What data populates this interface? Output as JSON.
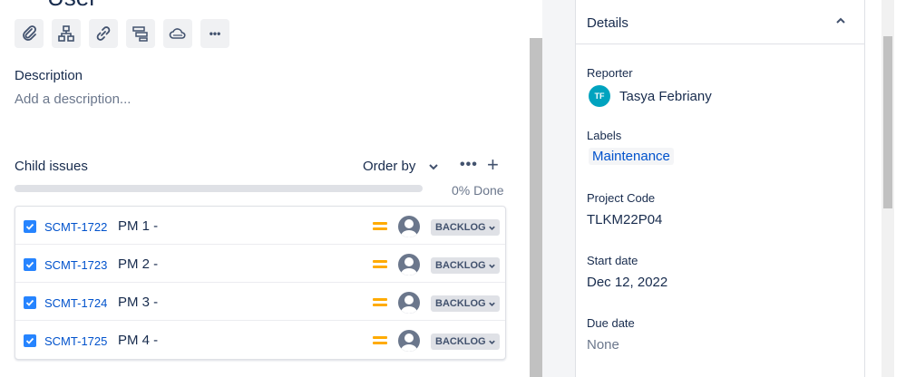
{
  "issue": {
    "title_fragment": "User"
  },
  "toolbar": {
    "buttons": [
      "attachment-icon",
      "hierarchy-icon",
      "link-icon",
      "roadmap-icon",
      "cloud-icon",
      "more-icon"
    ],
    "more_label": "•••"
  },
  "description": {
    "label": "Description",
    "placeholder": "Add a description..."
  },
  "child_issues": {
    "label": "Child issues",
    "order_by_label": "Order by",
    "more_label": "•••",
    "add_label": "+",
    "progress_text": "0% Done",
    "progress_fraction": 0,
    "items": [
      {
        "key": "SCMT-1722",
        "summary": "PM 1 -",
        "status": "BACKLOG",
        "priority": "medium"
      },
      {
        "key": "SCMT-1723",
        "summary": "PM 2 -",
        "status": "BACKLOG",
        "priority": "medium"
      },
      {
        "key": "SCMT-1724",
        "summary": "PM 3 -",
        "status": "BACKLOG",
        "priority": "medium"
      },
      {
        "key": "SCMT-1725",
        "summary": "PM 4 -",
        "status": "BACKLOG",
        "priority": "medium"
      }
    ]
  },
  "details": {
    "title": "Details",
    "reporter_label": "Reporter",
    "reporter_initials": "TF",
    "reporter_name": "Tasya Febriany",
    "labels_label": "Labels",
    "label_value": "Maintenance",
    "project_code_label": "Project Code",
    "project_code_value": "TLKM22P04",
    "start_date_label": "Start date",
    "start_date_value": "Dec 12, 2022",
    "due_date_label": "Due date",
    "due_date_value": "None"
  },
  "colors": {
    "link": "#0052cc",
    "checkbox": "#2684ff",
    "priority_medium": "#ffab00",
    "reporter_avatar": "#00a3bf"
  }
}
